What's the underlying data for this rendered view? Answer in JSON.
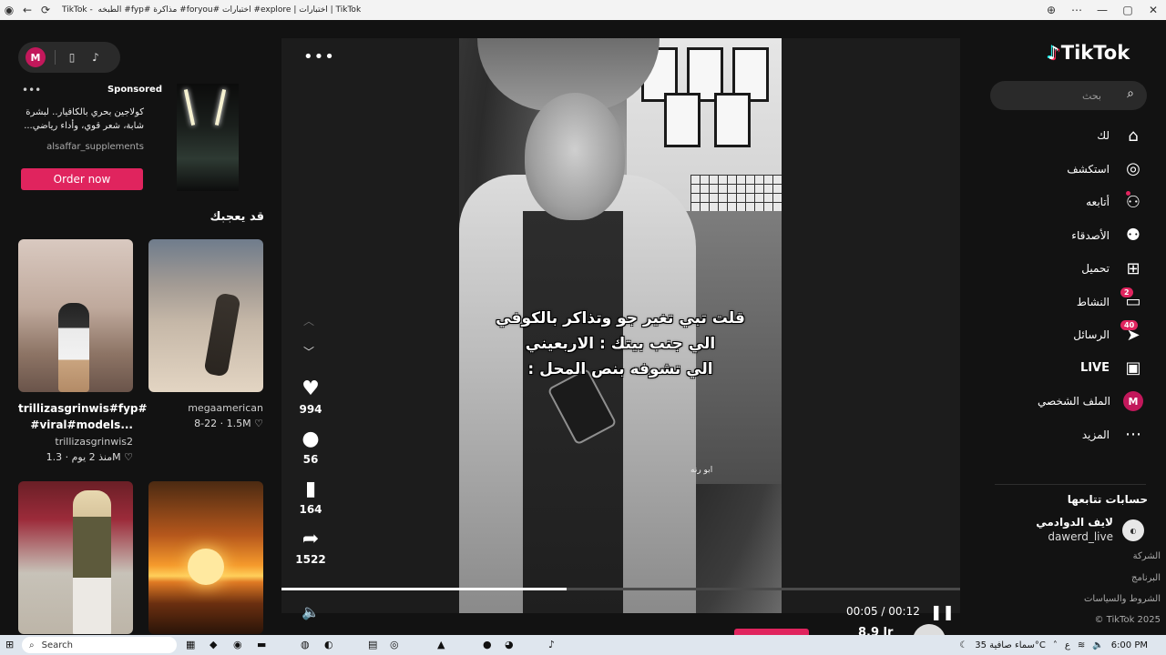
{
  "window": {
    "title": "TikTok - ﻿﻿﻿﻿﻿﻿﻿﻿﻿﻿﻿﻿﻿﻿﻿﻿ الطبخه #fyp# مذاكرة #foryou# اختبارات #explore | اختبارات | TikTok",
    "back_icon": "back-arrow-icon",
    "refresh_icon": "refresh-icon"
  },
  "left": {
    "avatar_letter": "M",
    "ad": {
      "sponsored_label": "Sponsored",
      "text": "كولاجين بحري بالكافيار.. لبشرة شابة، شعر قوي، وأداء رياضي...",
      "handle": "alsaffar_supplements",
      "button": "Order now"
    },
    "section_title": "قد يعجبك",
    "cards": [
      {
        "title": "trillizasgrinwis#fyp# #viral#models...",
        "handle": "trillizasgrinwis2",
        "likes": "1.3M",
        "date": "منذ 2 يوم"
      },
      {
        "title": "",
        "handle": "megaamerican",
        "likes": "1.5M",
        "date": "8-22"
      }
    ]
  },
  "player": {
    "caption_lines": [
      "قلت تبي تغير جو وتذاكر بالكوفي",
      "الي جنب بيتك : الاربعيني",
      "الي تشوفه بنص المحل :"
    ],
    "watermark": "ابو رنه",
    "likes": "994",
    "comments": "56",
    "saves": "164",
    "shares": "1522",
    "time": "00:05 / 00:12",
    "progress": 0.42,
    "below_text": "ا 8.9r"
  },
  "right": {
    "logo": "TikTok",
    "search_placeholder": "بحث",
    "nav": [
      {
        "label": "لك",
        "icon": "home-icon"
      },
      {
        "label": "استكشف",
        "icon": "compass-icon"
      },
      {
        "label": "أتابعه",
        "icon": "following-icon"
      },
      {
        "label": "الأصدقاء",
        "icon": "friends-icon"
      },
      {
        "label": "تحميل",
        "icon": "upload-icon"
      },
      {
        "label": "النشاط",
        "icon": "activity-icon",
        "badge": "2"
      },
      {
        "label": "الرسائل",
        "icon": "messages-icon",
        "badge": "40"
      },
      {
        "label": "LIVE",
        "icon": "live-icon"
      },
      {
        "label": "الملف الشخصي",
        "icon": "profile-avatar",
        "avatar_letter": "M"
      },
      {
        "label": "المزيد",
        "icon": "more-icon"
      }
    ],
    "following_title": "حسابات تتابعها",
    "following": [
      {
        "name": "لايف الدوادمي",
        "handle": "dawerd_live"
      }
    ],
    "footer": [
      "الشركة",
      "البرنامج",
      "الشروط والسياسات",
      "TikTok 2025 ©"
    ]
  },
  "taskbar": {
    "search": "Search",
    "weather": "سماء صافية  35°C",
    "lang": "ع",
    "clock": "6:00 PM"
  }
}
